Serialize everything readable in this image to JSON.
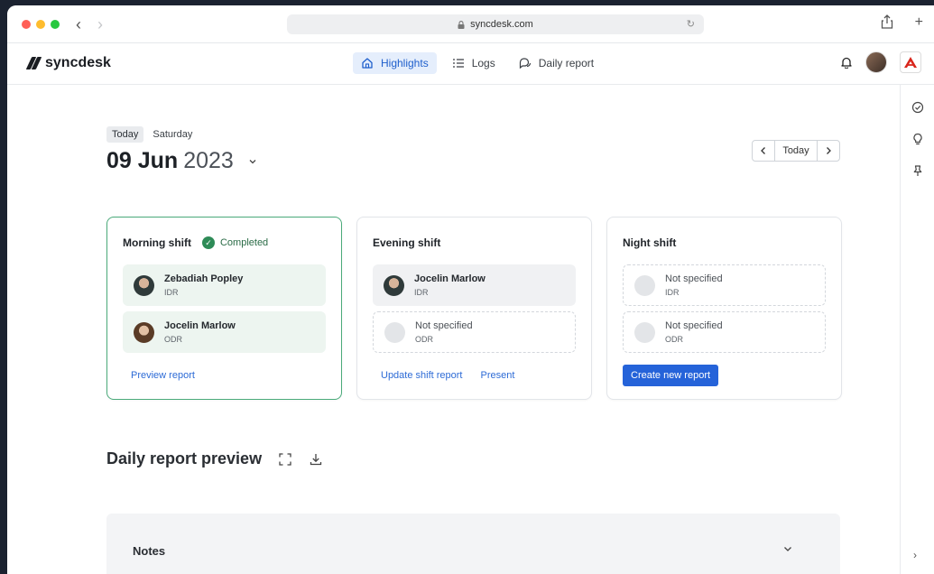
{
  "browser": {
    "url": "syncdesk.com"
  },
  "app": {
    "brand": "syncdesk"
  },
  "nav": {
    "tabs": [
      {
        "label": "Highlights",
        "icon": "home-icon",
        "active": true
      },
      {
        "label": "Logs",
        "icon": "list-icon",
        "active": false
      },
      {
        "label": "Daily report",
        "icon": "chat-icon",
        "active": false
      }
    ]
  },
  "date": {
    "chip": "Today",
    "weekday": "Saturday",
    "day_month": "09 Jun",
    "year": "2023",
    "pager_today": "Today"
  },
  "shifts": [
    {
      "title": "Morning shift",
      "status": "Completed",
      "slots": [
        {
          "name": "Zebadiah Popley",
          "role": "IDR"
        },
        {
          "name": "Jocelin Marlow",
          "role": "ODR"
        }
      ],
      "actions": [
        "Preview report"
      ]
    },
    {
      "title": "Evening shift",
      "slots": [
        {
          "name": "Jocelin Marlow",
          "role": "IDR"
        },
        {
          "name": "Not specified",
          "role": "ODR"
        }
      ],
      "actions": [
        "Update shift report",
        "Present"
      ]
    },
    {
      "title": "Night shift",
      "slots": [
        {
          "name": "Not specified",
          "role": "IDR"
        },
        {
          "name": "Not specified",
          "role": "ODR"
        }
      ],
      "actions": [
        "Create new report"
      ]
    }
  ],
  "preview": {
    "title": "Daily report preview"
  },
  "notes": {
    "title": "Notes"
  },
  "colors": {
    "accent": "#2563d9",
    "success": "#2e8b57",
    "active_tab_bg": "#e5eefc"
  }
}
